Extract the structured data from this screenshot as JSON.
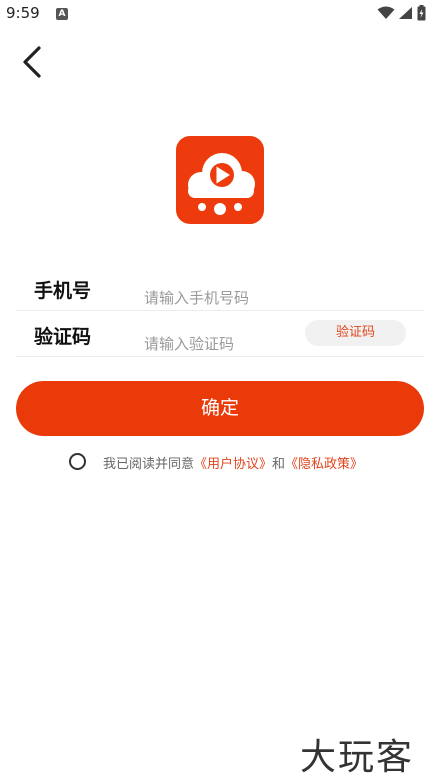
{
  "status_bar": {
    "time": "9:59",
    "notification_badge": "A",
    "icons": [
      "wifi-icon",
      "signal-icon",
      "battery-icon"
    ]
  },
  "nav": {
    "back_icon": "chevron-left-icon"
  },
  "logo": {
    "icon": "cloud-play-icon",
    "color": "#ed3b0d"
  },
  "form": {
    "phone": {
      "label": "手机号",
      "placeholder": "请输入手机号码",
      "value": ""
    },
    "code": {
      "label": "验证码",
      "placeholder": "请输入验证码",
      "value": "",
      "get_code_button": "验证码"
    }
  },
  "confirm_button": "确定",
  "agreement": {
    "checked": false,
    "prefix": "我已阅读并同意",
    "user_agreement": "《用户协议》",
    "and": "和",
    "privacy_policy": "《隐私政策》"
  },
  "watermark": "大玩客",
  "colors": {
    "accent": "#ea3a0a",
    "link": "#e2451d"
  }
}
